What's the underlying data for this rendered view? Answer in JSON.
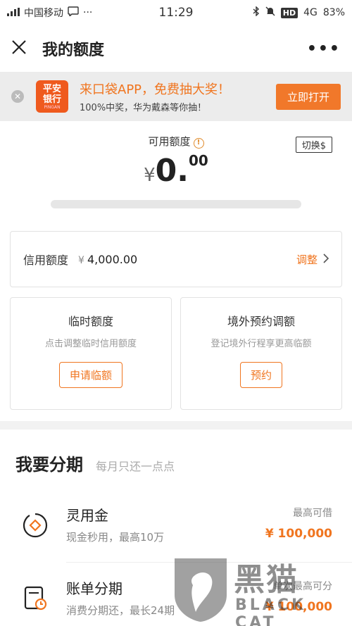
{
  "status_bar": {
    "carrier": "中国移动",
    "time": "11:29",
    "network": "4G",
    "battery": "83%",
    "hd": "HD"
  },
  "nav": {
    "title": "我的额度"
  },
  "promo": {
    "logo_line1": "平安",
    "logo_line2": "银行",
    "logo_sub": "PINGAN",
    "headline": "来口袋APP，免费抽大奖！",
    "subline": "100%中奖，华为戴森等你抽！",
    "open_label": "立即打开"
  },
  "amount": {
    "label": "可用额度",
    "switch_label": "切换$",
    "currency": "¥",
    "integer": "0.",
    "decimal": "00",
    "usage_fraction": 0
  },
  "credit": {
    "label": "信用额度",
    "currency": "¥",
    "value": "4,000.00",
    "adjust_label": "调整"
  },
  "cards": [
    {
      "title": "临时额度",
      "desc": "点击调整临时信用额度",
      "button": "申请临额"
    },
    {
      "title": "境外预约调额",
      "desc": "登记境外行程享更高临额",
      "button": "预约"
    }
  ],
  "installment": {
    "title": "我要分期",
    "subtitle": "每月只还一点点",
    "items": [
      {
        "name": "灵用金",
        "desc": "现金秒用，最高10万",
        "right_label": "最高可借",
        "right_value": "¥ 100,000",
        "icon": "cash-icon"
      },
      {
        "name": "账单分期",
        "desc": "消费分期还，最长24期",
        "right_label": "单次最高可分",
        "right_value": "¥ 100,000",
        "icon": "bill-clock-icon"
      }
    ]
  },
  "watermark": {
    "cn": "黑猫",
    "en": "BLACK CAT"
  },
  "colors": {
    "accent": "#f0751f",
    "brand_red": "#ef5a1e"
  }
}
